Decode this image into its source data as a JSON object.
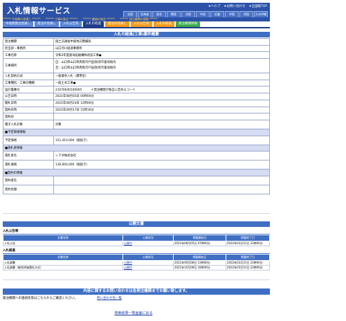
{
  "header": {
    "title": "入札情報サービス",
    "top_links": [
      "★ヘルプ",
      "★お問い合わせ",
      "★全国版TOP"
    ],
    "regions": [
      "全国",
      "北海道",
      "東北",
      "関東",
      "北陸",
      "中部",
      "近畿",
      "中国",
      "四国",
      "九州沖縄"
    ],
    "band": [
      "****** 中長期の見通し ******",
      "****** 工事の発注 ******",
      "****** 業務の発注 ******",
      "****** 発注機関の情報 ******"
    ]
  },
  "tabs": [
    {
      "label": "中長期発注見通し",
      "color": "blue"
    },
    {
      "label": "発注の見通し",
      "color": "blue"
    },
    {
      "label": "入札公告等",
      "color": "blue"
    },
    {
      "label": "入札の経過",
      "color": "active"
    },
    {
      "label": "発注の見通し",
      "color": "orange"
    },
    {
      "label": "入札公告等",
      "color": "orange"
    },
    {
      "label": "入札の経過",
      "color": "orange"
    },
    {
      "label": "発注機関情報",
      "color": "green"
    }
  ],
  "main": {
    "section_title": "入札の経過(工事)案件概要",
    "rows": [
      {
        "k": "発注機関",
        "v": "国土交通省中国地方整備局"
      },
      {
        "k": "担当部・事務所",
        "v": "山口河川国道事務所"
      },
      {
        "k": "工事名称",
        "v": "令和2年度富海拡幅構林改良工事●"
      },
      {
        "k": "工事場所",
        "v": "自：山口県山口県周南市戸田/防府市富海地内",
        "v2": "至：山口県山口県周南市戸田/防府市富海地内"
      },
      {
        "k": "入札契約方式",
        "v": "一般競争入札（標準型）"
      },
      {
        "k": "工事種別／工事の種類",
        "v": "一般土木工事●"
      },
      {
        "k": "設計書番号",
        "v": "21070040100005",
        "v2": "＊発注機関が独自に定めるコード"
      },
      {
        "k": "公告日時",
        "v": "2021年08月05日 00時00分"
      },
      {
        "k": "開札日時",
        "v": "2021年08月24日 12時00分"
      },
      {
        "k": "契約日時",
        "v": "2021年09月17日 15時16分"
      },
      {
        "k": "契約日",
        "v": ""
      },
      {
        "k": "電子入札対象",
        "v": "対象"
      }
    ],
    "group_yotei": "■予定価格情報",
    "yotei": {
      "k": "予定価格",
      "v": "151,410,000（税抜き）"
    },
    "group_rakusatsu": "■落札者情報",
    "rakusatsu": [
      {
        "k": "落札者名",
        "v": "シマダ株式会社"
      },
      {
        "k": "落札価格",
        "v": "136,000,000（税抜き）"
      }
    ],
    "group_keiyaku": "■契約の情報",
    "keiyaku": [
      {
        "k": "契約者名",
        "v": ""
      },
      {
        "k": "契約金額",
        "v": ""
      }
    ]
  },
  "public_docs": {
    "title": "公開文書",
    "koukoku": {
      "label": "入札公告等",
      "headers": [
        "文書名称",
        "公開状況",
        "掲載開始日",
        "掲載終了日"
      ],
      "rows": [
        [
          "入札公告",
          "公開中",
          "2021年08月05日 07時00分",
          "2022年03月31日 23時00分"
        ]
      ]
    },
    "keika": {
      "label": "入札経過",
      "headers": [
        "文書名称",
        "公開状況",
        "掲載開始日",
        "掲載終了日"
      ],
      "rows": [
        [
          "入札調書",
          "公開中",
          "2021年09月08日 13時00分",
          "2022年03月31日 23時00分"
        ],
        [
          "入札調書（総合評価落札方式）",
          "公開中",
          "2021年10月08日 18時40分",
          "2022年03月31日 23時00分"
        ]
      ]
    }
  },
  "contact": {
    "title": "内容に関するお問い合わせは各発注機関までお願い致します。",
    "text": "発注機関への連絡先等はこちらからご確認ください。",
    "link": "問い合わせ先一覧"
  },
  "back_link": "検索結果一覧画面に戻る"
}
